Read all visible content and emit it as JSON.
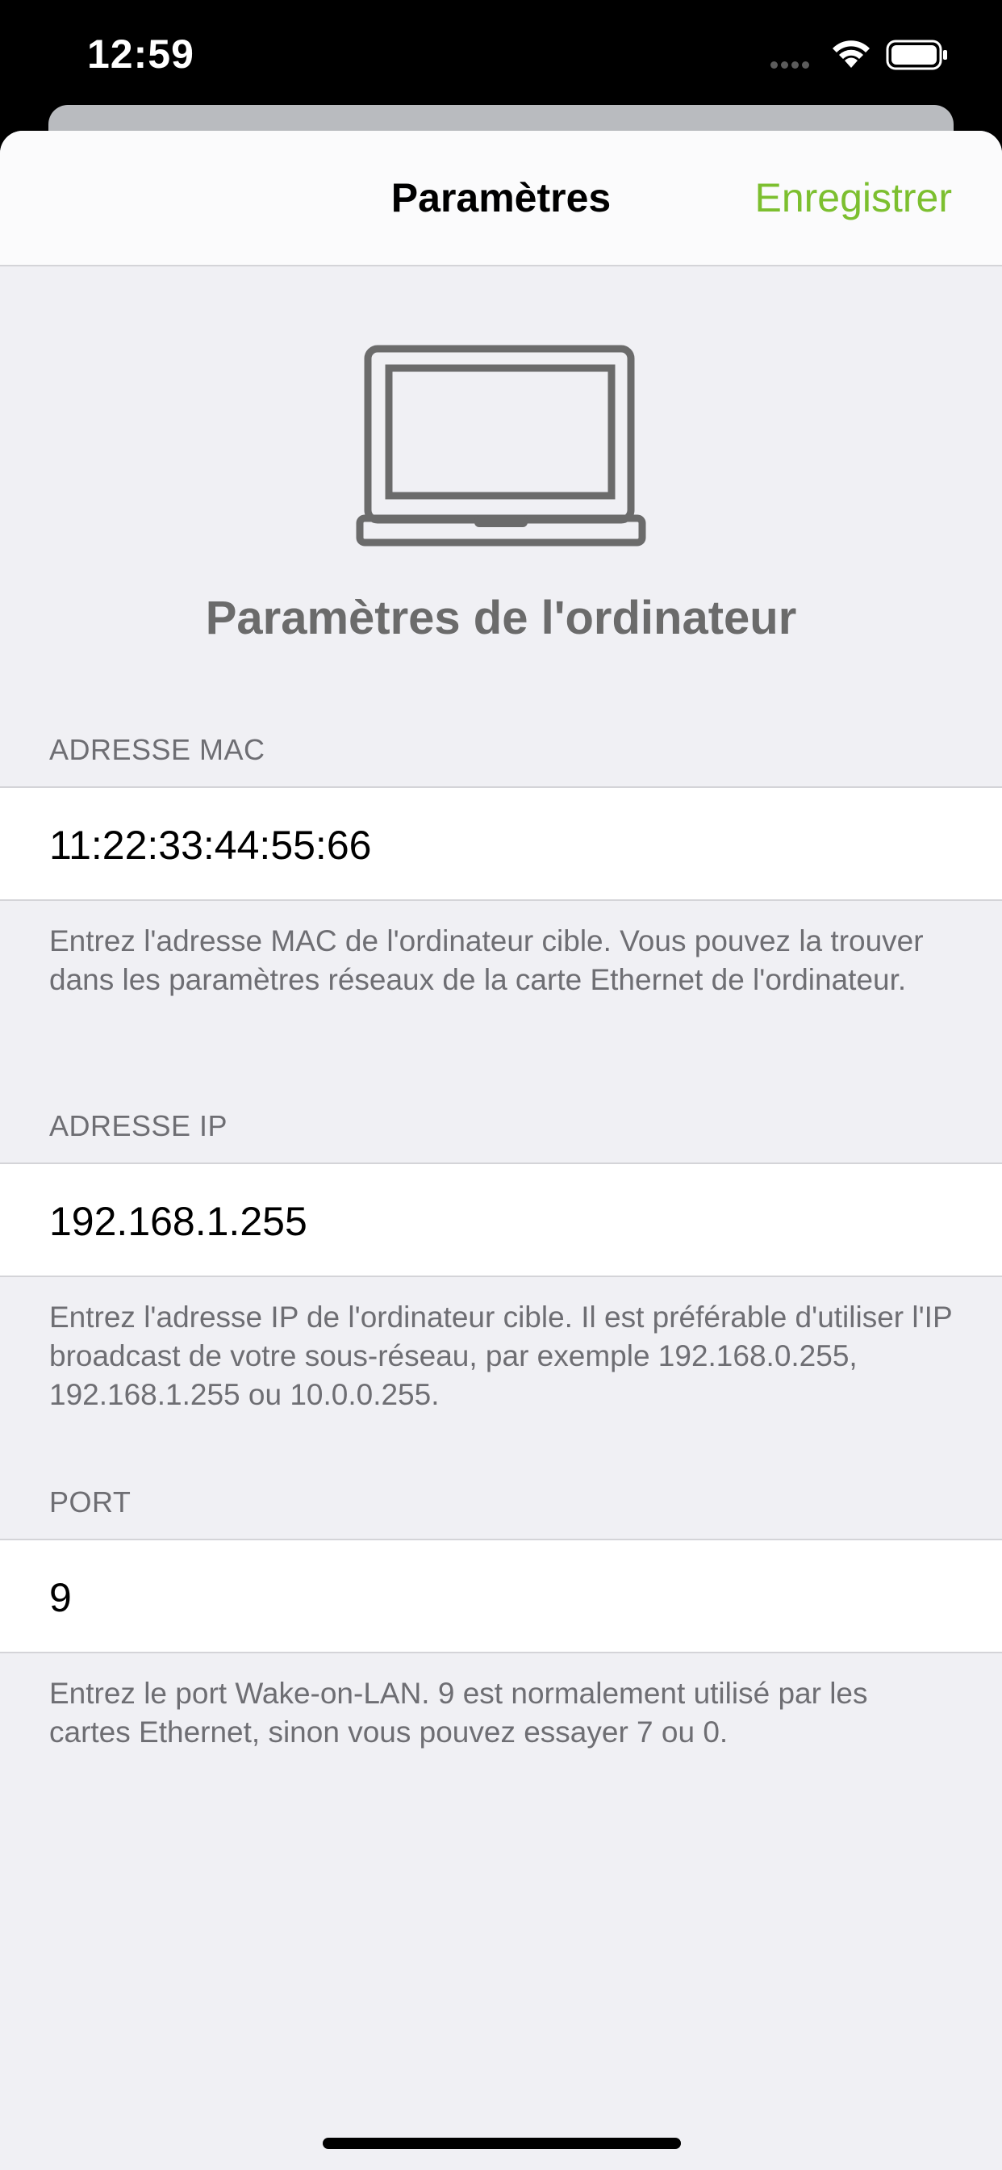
{
  "status_bar": {
    "time": "12:59"
  },
  "nav": {
    "title": "Paramètres",
    "save_label": "Enregistrer"
  },
  "hero": {
    "icon": "laptop-icon",
    "title": "Paramètres de l'ordinateur"
  },
  "sections": {
    "mac": {
      "header": "ADRESSE MAC",
      "value": "11:22:33:44:55:66",
      "footer": "Entrez l'adresse MAC de l'ordinateur cible. Vous pouvez la trouver dans les paramètres réseaux de la carte Ethernet de l'ordinateur."
    },
    "ip": {
      "header": "ADRESSE IP",
      "value": "192.168.1.255",
      "footer": "Entrez l'adresse IP de l'ordinateur cible. Il est préférable d'utiliser l'IP broadcast de votre sous-réseau, par exemple 192.168.0.255, 192.168.1.255 ou 10.0.0.255."
    },
    "port": {
      "header": "PORT",
      "value": "9",
      "footer": "Entrez le port Wake-on-LAN. 9 est normalement utilisé par les cartes Ethernet, sinon vous pouvez essayer 7 ou 0."
    }
  },
  "colors": {
    "accent": "#7cbf2f",
    "background": "#f0f0f4",
    "secondary_text": "#6e6e73"
  }
}
